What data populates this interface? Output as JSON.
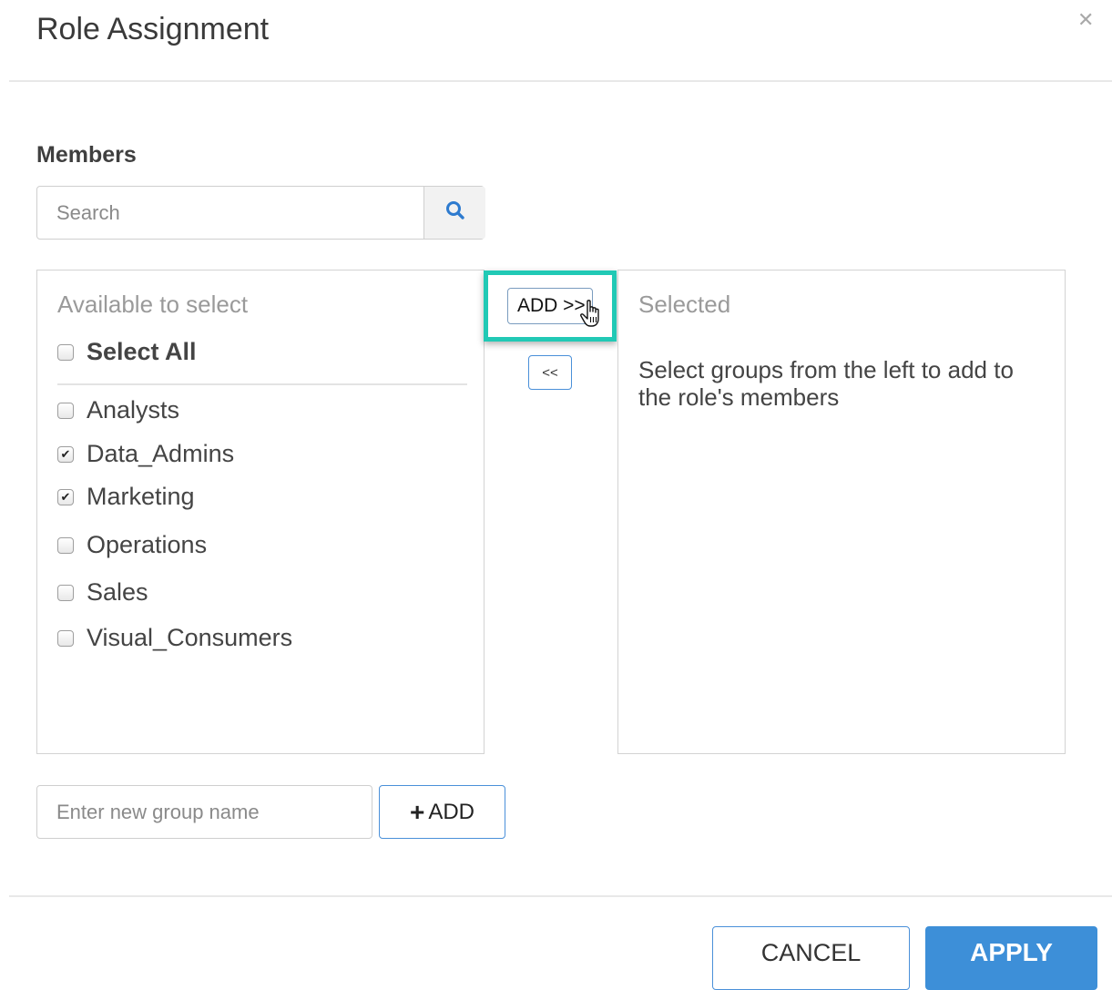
{
  "dialog": {
    "title": "Role Assignment",
    "close_icon": "close-icon"
  },
  "members": {
    "label": "Members",
    "search": {
      "placeholder": "Search",
      "value": "",
      "icon": "search-icon"
    },
    "available": {
      "header": "Available to select",
      "select_all": {
        "label": "Select All",
        "checked": false
      },
      "items": [
        {
          "label": "Analysts",
          "checked": false
        },
        {
          "label": "Data_Admins",
          "checked": true
        },
        {
          "label": "Marketing",
          "checked": true
        },
        {
          "label": "Operations",
          "checked": false
        },
        {
          "label": "Sales",
          "checked": false
        },
        {
          "label": "Visual_Consumers",
          "checked": false
        }
      ]
    },
    "transfer": {
      "add_label": "ADD >>",
      "remove_label": "<<"
    },
    "selected": {
      "header": "Selected",
      "empty_text": "Select groups from the left to add to the role's members"
    },
    "new_group": {
      "placeholder": "Enter new group name",
      "value": "",
      "add_label": "ADD",
      "add_icon": "plus-icon"
    }
  },
  "footer": {
    "cancel_label": "CANCEL",
    "apply_label": "APPLY"
  },
  "colors": {
    "highlight": "#21c9b5",
    "primary": "#3d8fd8",
    "search_icon": "#2e7bcf"
  }
}
